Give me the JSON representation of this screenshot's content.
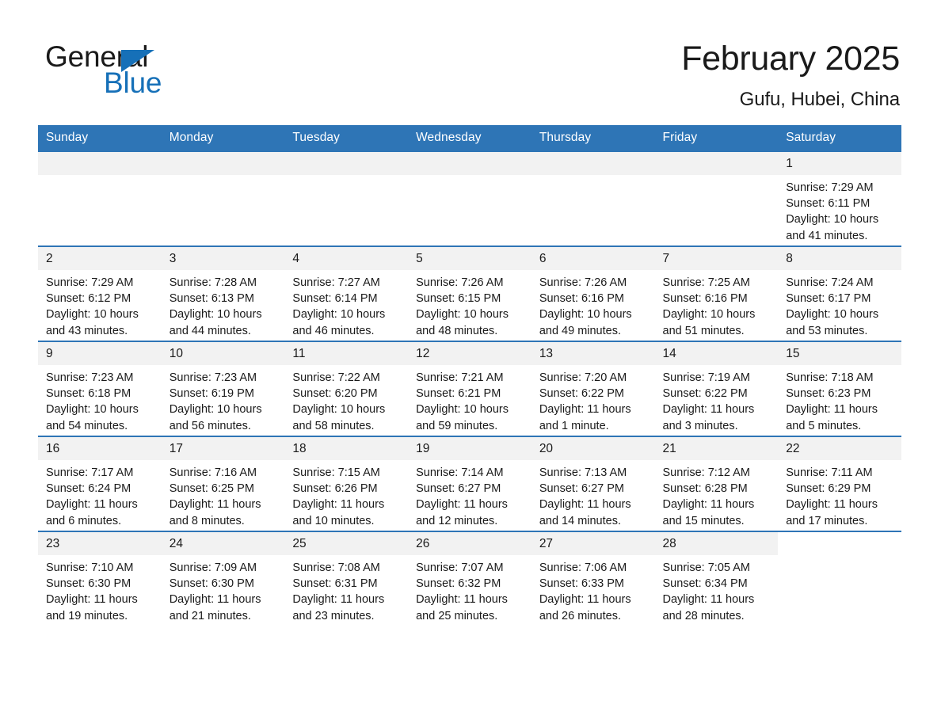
{
  "brand": {
    "name_part1": "General",
    "name_part2": "Blue",
    "accent_color": "#1670b8",
    "triangle_icon": "triangle-icon"
  },
  "header": {
    "month_title": "February 2025",
    "location": "Gufu, Hubei, China"
  },
  "calendar": {
    "header_color": "#2e75b6",
    "daynum_bg": "#f2f2f2",
    "weekdays": [
      "Sunday",
      "Monday",
      "Tuesday",
      "Wednesday",
      "Thursday",
      "Friday",
      "Saturday"
    ],
    "weeks": [
      [
        {
          "day": "",
          "blank": true
        },
        {
          "day": "",
          "blank": true
        },
        {
          "day": "",
          "blank": true
        },
        {
          "day": "",
          "blank": true
        },
        {
          "day": "",
          "blank": true
        },
        {
          "day": "",
          "blank": true
        },
        {
          "day": "1",
          "sunrise": "Sunrise: 7:29 AM",
          "sunset": "Sunset: 6:11 PM",
          "daylight": "Daylight: 10 hours and 41 minutes."
        }
      ],
      [
        {
          "day": "2",
          "sunrise": "Sunrise: 7:29 AM",
          "sunset": "Sunset: 6:12 PM",
          "daylight": "Daylight: 10 hours and 43 minutes."
        },
        {
          "day": "3",
          "sunrise": "Sunrise: 7:28 AM",
          "sunset": "Sunset: 6:13 PM",
          "daylight": "Daylight: 10 hours and 44 minutes."
        },
        {
          "day": "4",
          "sunrise": "Sunrise: 7:27 AM",
          "sunset": "Sunset: 6:14 PM",
          "daylight": "Daylight: 10 hours and 46 minutes."
        },
        {
          "day": "5",
          "sunrise": "Sunrise: 7:26 AM",
          "sunset": "Sunset: 6:15 PM",
          "daylight": "Daylight: 10 hours and 48 minutes."
        },
        {
          "day": "6",
          "sunrise": "Sunrise: 7:26 AM",
          "sunset": "Sunset: 6:16 PM",
          "daylight": "Daylight: 10 hours and 49 minutes."
        },
        {
          "day": "7",
          "sunrise": "Sunrise: 7:25 AM",
          "sunset": "Sunset: 6:16 PM",
          "daylight": "Daylight: 10 hours and 51 minutes."
        },
        {
          "day": "8",
          "sunrise": "Sunrise: 7:24 AM",
          "sunset": "Sunset: 6:17 PM",
          "daylight": "Daylight: 10 hours and 53 minutes."
        }
      ],
      [
        {
          "day": "9",
          "sunrise": "Sunrise: 7:23 AM",
          "sunset": "Sunset: 6:18 PM",
          "daylight": "Daylight: 10 hours and 54 minutes."
        },
        {
          "day": "10",
          "sunrise": "Sunrise: 7:23 AM",
          "sunset": "Sunset: 6:19 PM",
          "daylight": "Daylight: 10 hours and 56 minutes."
        },
        {
          "day": "11",
          "sunrise": "Sunrise: 7:22 AM",
          "sunset": "Sunset: 6:20 PM",
          "daylight": "Daylight: 10 hours and 58 minutes."
        },
        {
          "day": "12",
          "sunrise": "Sunrise: 7:21 AM",
          "sunset": "Sunset: 6:21 PM",
          "daylight": "Daylight: 10 hours and 59 minutes."
        },
        {
          "day": "13",
          "sunrise": "Sunrise: 7:20 AM",
          "sunset": "Sunset: 6:22 PM",
          "daylight": "Daylight: 11 hours and 1 minute."
        },
        {
          "day": "14",
          "sunrise": "Sunrise: 7:19 AM",
          "sunset": "Sunset: 6:22 PM",
          "daylight": "Daylight: 11 hours and 3 minutes."
        },
        {
          "day": "15",
          "sunrise": "Sunrise: 7:18 AM",
          "sunset": "Sunset: 6:23 PM",
          "daylight": "Daylight: 11 hours and 5 minutes."
        }
      ],
      [
        {
          "day": "16",
          "sunrise": "Sunrise: 7:17 AM",
          "sunset": "Sunset: 6:24 PM",
          "daylight": "Daylight: 11 hours and 6 minutes."
        },
        {
          "day": "17",
          "sunrise": "Sunrise: 7:16 AM",
          "sunset": "Sunset: 6:25 PM",
          "daylight": "Daylight: 11 hours and 8 minutes."
        },
        {
          "day": "18",
          "sunrise": "Sunrise: 7:15 AM",
          "sunset": "Sunset: 6:26 PM",
          "daylight": "Daylight: 11 hours and 10 minutes."
        },
        {
          "day": "19",
          "sunrise": "Sunrise: 7:14 AM",
          "sunset": "Sunset: 6:27 PM",
          "daylight": "Daylight: 11 hours and 12 minutes."
        },
        {
          "day": "20",
          "sunrise": "Sunrise: 7:13 AM",
          "sunset": "Sunset: 6:27 PM",
          "daylight": "Daylight: 11 hours and 14 minutes."
        },
        {
          "day": "21",
          "sunrise": "Sunrise: 7:12 AM",
          "sunset": "Sunset: 6:28 PM",
          "daylight": "Daylight: 11 hours and 15 minutes."
        },
        {
          "day": "22",
          "sunrise": "Sunrise: 7:11 AM",
          "sunset": "Sunset: 6:29 PM",
          "daylight": "Daylight: 11 hours and 17 minutes."
        }
      ],
      [
        {
          "day": "23",
          "sunrise": "Sunrise: 7:10 AM",
          "sunset": "Sunset: 6:30 PM",
          "daylight": "Daylight: 11 hours and 19 minutes."
        },
        {
          "day": "24",
          "sunrise": "Sunrise: 7:09 AM",
          "sunset": "Sunset: 6:30 PM",
          "daylight": "Daylight: 11 hours and 21 minutes."
        },
        {
          "day": "25",
          "sunrise": "Sunrise: 7:08 AM",
          "sunset": "Sunset: 6:31 PM",
          "daylight": "Daylight: 11 hours and 23 minutes."
        },
        {
          "day": "26",
          "sunrise": "Sunrise: 7:07 AM",
          "sunset": "Sunset: 6:32 PM",
          "daylight": "Daylight: 11 hours and 25 minutes."
        },
        {
          "day": "27",
          "sunrise": "Sunrise: 7:06 AM",
          "sunset": "Sunset: 6:33 PM",
          "daylight": "Daylight: 11 hours and 26 minutes."
        },
        {
          "day": "28",
          "sunrise": "Sunrise: 7:05 AM",
          "sunset": "Sunset: 6:34 PM",
          "daylight": "Daylight: 11 hours and 28 minutes."
        },
        {
          "day": "",
          "empty": true
        }
      ]
    ]
  }
}
